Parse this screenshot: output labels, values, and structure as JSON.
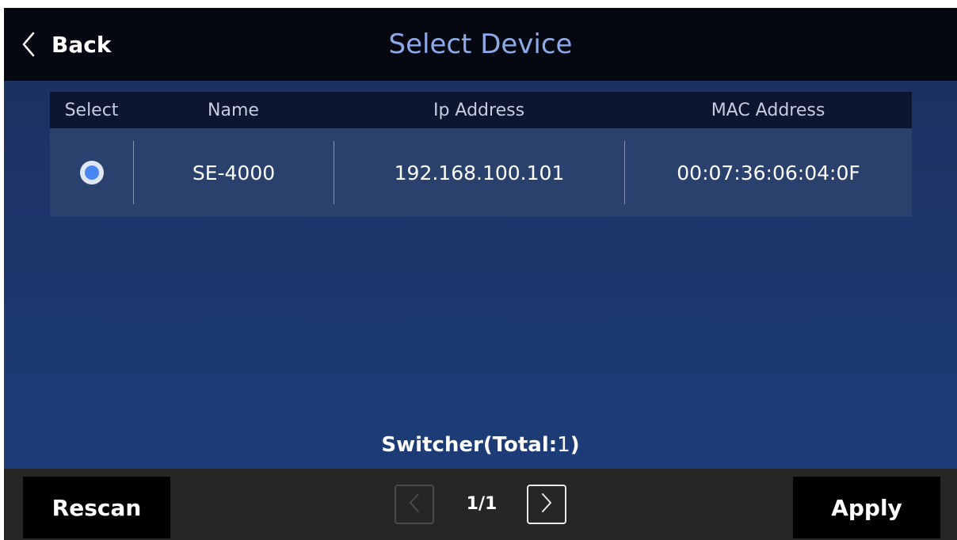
{
  "header": {
    "back_label": "Back",
    "title": "Select Device"
  },
  "table": {
    "columns": [
      "Select",
      "Name",
      "Ip Address",
      "MAC Address"
    ],
    "rows": [
      {
        "selected": true,
        "name": "SE-4000",
        "ip": "192.168.100.101",
        "mac": "00:07:36:06:04:0F"
      }
    ]
  },
  "summary": {
    "prefix": "Switcher(Total:",
    "count": "1",
    "suffix": ")"
  },
  "footer": {
    "rescan_label": "Rescan",
    "apply_label": "Apply",
    "page": "1/1"
  },
  "colors": {
    "title": "#8ea9e8",
    "radio_selected": "#4a86ef",
    "header_bg": "#050811",
    "footer_bg": "#262626"
  }
}
